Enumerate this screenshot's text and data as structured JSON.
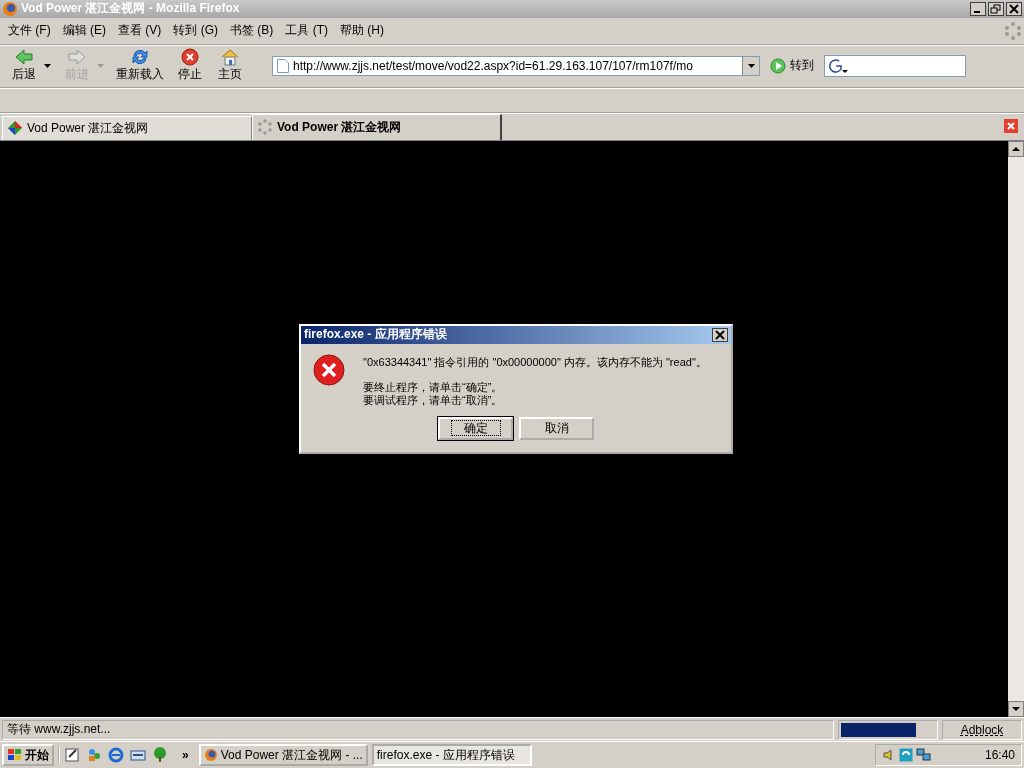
{
  "window": {
    "title": "Vod Power 湛江金视网 - Mozilla Firefox"
  },
  "menu": [
    "文件 (F)",
    "编辑 (E)",
    "查看 (V)",
    "转到 (G)",
    "书签 (B)",
    "工具 (T)",
    "帮助 (H)"
  ],
  "toolbar": [
    {
      "kind": "back",
      "label": "后退",
      "disabled": false,
      "dropdown": true
    },
    {
      "kind": "forward",
      "label": "前进",
      "disabled": true,
      "dropdown": true
    },
    {
      "kind": "reload",
      "label": "重新载入",
      "disabled": false,
      "dropdown": false
    },
    {
      "kind": "stop",
      "label": "停止",
      "disabled": false,
      "dropdown": false
    },
    {
      "kind": "home",
      "label": "主页",
      "disabled": false,
      "dropdown": false
    }
  ],
  "address": {
    "value": "http://www.zjjs.net/test/move/vod22.aspx?id=61.29.163.107/107/rm107f/mo"
  },
  "go_button": "转到",
  "tabs": [
    {
      "label": "Vod Power 湛江金视网",
      "selected": false,
      "loading": false
    },
    {
      "label": "Vod Power 湛江金视网",
      "selected": true,
      "loading": true
    }
  ],
  "dialog": {
    "title": "firefox.exe - 应用程序错误",
    "message": "\"0x63344341\" 指令引用的 \"0x00000000\" 内存。该内存不能为 \"read\"。",
    "instructions": [
      "要终止程序，请单击“确定”。",
      "要调试程序，请单击“取消”。"
    ],
    "buttons": [
      {
        "label": "确定",
        "selected": true
      },
      {
        "label": "取消",
        "selected": false
      }
    ]
  },
  "status_bar": {
    "text": "等待 www.zjjs.net...",
    "level": 0.8,
    "adblock": "Adblock"
  },
  "taskbar": {
    "start": "开始",
    "more": "»",
    "tasks": [
      {
        "label": "Vod Power 湛江金视网 - ...",
        "selected": false
      },
      {
        "label": "firefox.exe - 应用程序错误",
        "selected": true
      }
    ],
    "clock": "16:40"
  }
}
